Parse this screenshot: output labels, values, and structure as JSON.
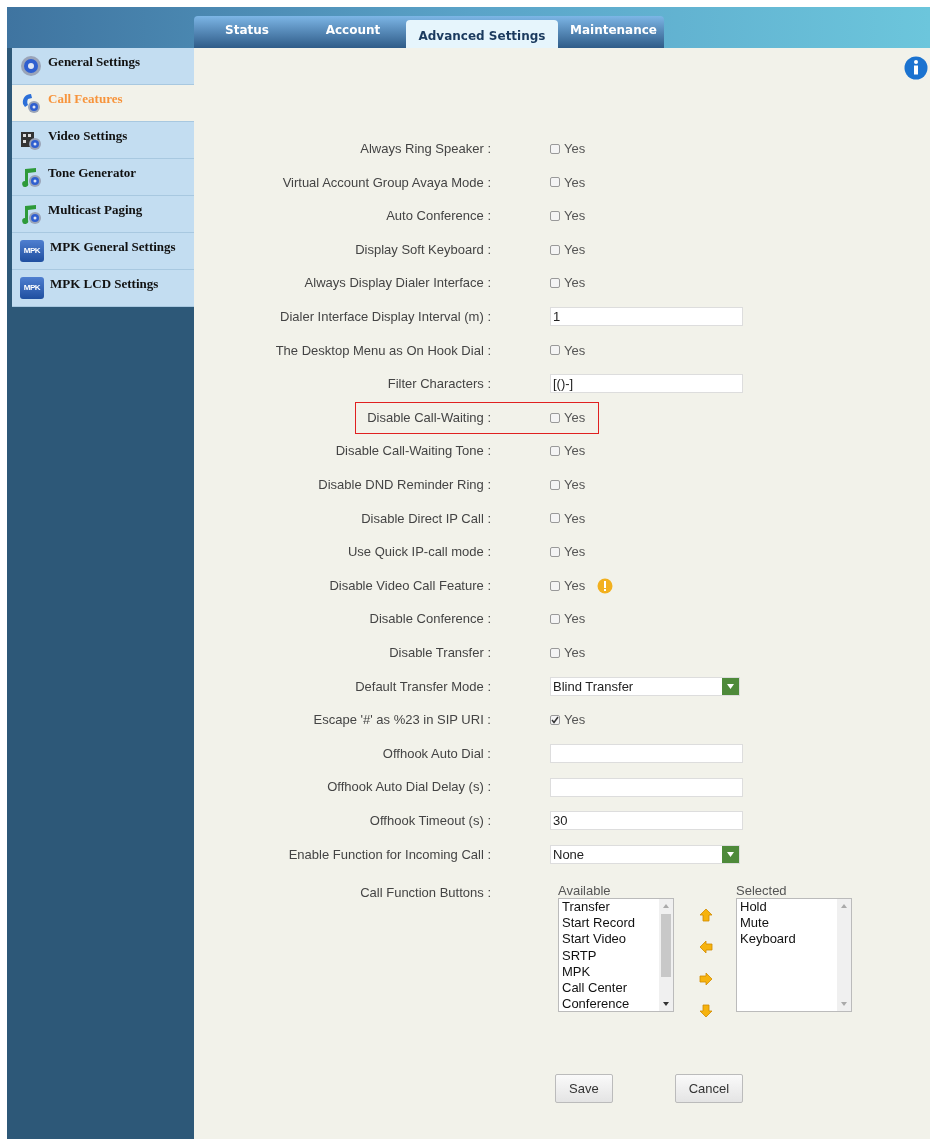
{
  "tabs": [
    {
      "label": "Status",
      "selected": false
    },
    {
      "label": "Account",
      "selected": false
    },
    {
      "label": "Advanced Settings",
      "selected": true
    },
    {
      "label": "Maintenance",
      "selected": false
    }
  ],
  "sidebar": {
    "items": [
      {
        "label": "General Settings",
        "selected": false,
        "kind": "gear"
      },
      {
        "label": "Call Features",
        "selected": true,
        "kind": "phone"
      },
      {
        "label": "Video Settings",
        "selected": false,
        "kind": "film"
      },
      {
        "label": "Tone Generator",
        "selected": false,
        "kind": "music"
      },
      {
        "label": "Multicast Paging",
        "selected": false,
        "kind": "music"
      },
      {
        "label": "MPK General Settings",
        "selected": false,
        "kind": "mpk",
        "icon_text": "MPK"
      },
      {
        "label": "MPK LCD Settings",
        "selected": false,
        "kind": "mpk",
        "icon_text": "MPK"
      }
    ]
  },
  "form": {
    "rows": [
      {
        "label": "Always Ring Speaker :",
        "kind": "checkbox",
        "option": "Yes",
        "checked": false,
        "highlighted": false,
        "warning": false
      },
      {
        "label": "Virtual Account Group Avaya Mode :",
        "kind": "checkbox",
        "option": "Yes",
        "checked": false,
        "highlighted": false,
        "warning": false
      },
      {
        "label": "Auto Conference :",
        "kind": "checkbox",
        "option": "Yes",
        "checked": false,
        "highlighted": false,
        "warning": false
      },
      {
        "label": "Display Soft Keyboard :",
        "kind": "checkbox",
        "option": "Yes",
        "checked": false,
        "highlighted": false,
        "warning": false
      },
      {
        "label": "Always Display Dialer Interface :",
        "kind": "checkbox",
        "option": "Yes",
        "checked": false,
        "highlighted": false,
        "warning": false
      },
      {
        "label": "Dialer Interface Display Interval (m) :",
        "kind": "text",
        "value": "1",
        "highlighted": false,
        "warning": false
      },
      {
        "label": "The Desktop Menu as On Hook Dial :",
        "kind": "checkbox",
        "option": "Yes",
        "checked": false,
        "highlighted": false,
        "warning": false
      },
      {
        "label": "Filter Characters :",
        "kind": "text",
        "value": "[()-]",
        "highlighted": false,
        "warning": false
      },
      {
        "label": "Disable Call-Waiting :",
        "kind": "checkbox",
        "option": "Yes",
        "checked": false,
        "highlighted": true,
        "warning": false
      },
      {
        "label": "Disable Call-Waiting Tone :",
        "kind": "checkbox",
        "option": "Yes",
        "checked": false,
        "highlighted": false,
        "warning": false
      },
      {
        "label": "Disable DND Reminder Ring :",
        "kind": "checkbox",
        "option": "Yes",
        "checked": false,
        "highlighted": false,
        "warning": false
      },
      {
        "label": "Disable Direct IP Call :",
        "kind": "checkbox",
        "option": "Yes",
        "checked": false,
        "highlighted": false,
        "warning": false
      },
      {
        "label": "Use Quick IP-call mode :",
        "kind": "checkbox",
        "option": "Yes",
        "checked": false,
        "highlighted": false,
        "warning": false
      },
      {
        "label": "Disable Video Call Feature :",
        "kind": "checkbox",
        "option": "Yes",
        "checked": false,
        "highlighted": false,
        "warning": true
      },
      {
        "label": "Disable Conference :",
        "kind": "checkbox",
        "option": "Yes",
        "checked": false,
        "highlighted": false,
        "warning": false
      },
      {
        "label": "Disable Transfer :",
        "kind": "checkbox",
        "option": "Yes",
        "checked": false,
        "highlighted": false,
        "warning": false
      },
      {
        "label": "Default Transfer Mode :",
        "kind": "select",
        "value": "Blind Transfer",
        "highlighted": false,
        "warning": false
      },
      {
        "label": "Escape '#' as %23 in SIP URI :",
        "kind": "checkbox",
        "option": "Yes",
        "checked": true,
        "highlighted": false,
        "warning": false
      },
      {
        "label": "Offhook Auto Dial :",
        "kind": "text",
        "value": "",
        "highlighted": false,
        "warning": false
      },
      {
        "label": "Offhook Auto Dial Delay (s) :",
        "kind": "text",
        "value": "",
        "highlighted": false,
        "warning": false
      },
      {
        "label": "Offhook Timeout (s) :",
        "kind": "text",
        "value": "30",
        "highlighted": false,
        "warning": false
      },
      {
        "label": "Enable Function for Incoming Call :",
        "kind": "select",
        "value": "None",
        "highlighted": false,
        "warning": false
      }
    ]
  },
  "call_function_buttons": {
    "label": "Call Function Buttons :",
    "available": {
      "title": "Available",
      "items": [
        "Transfer",
        "Start Record",
        "Start Video",
        "SRTP",
        "MPK",
        "Call Center",
        "Conference"
      ]
    },
    "selected": {
      "title": "Selected",
      "items": [
        "Hold",
        "Mute",
        "Keyboard"
      ]
    }
  },
  "buttons": [
    "Save",
    "Cancel"
  ]
}
